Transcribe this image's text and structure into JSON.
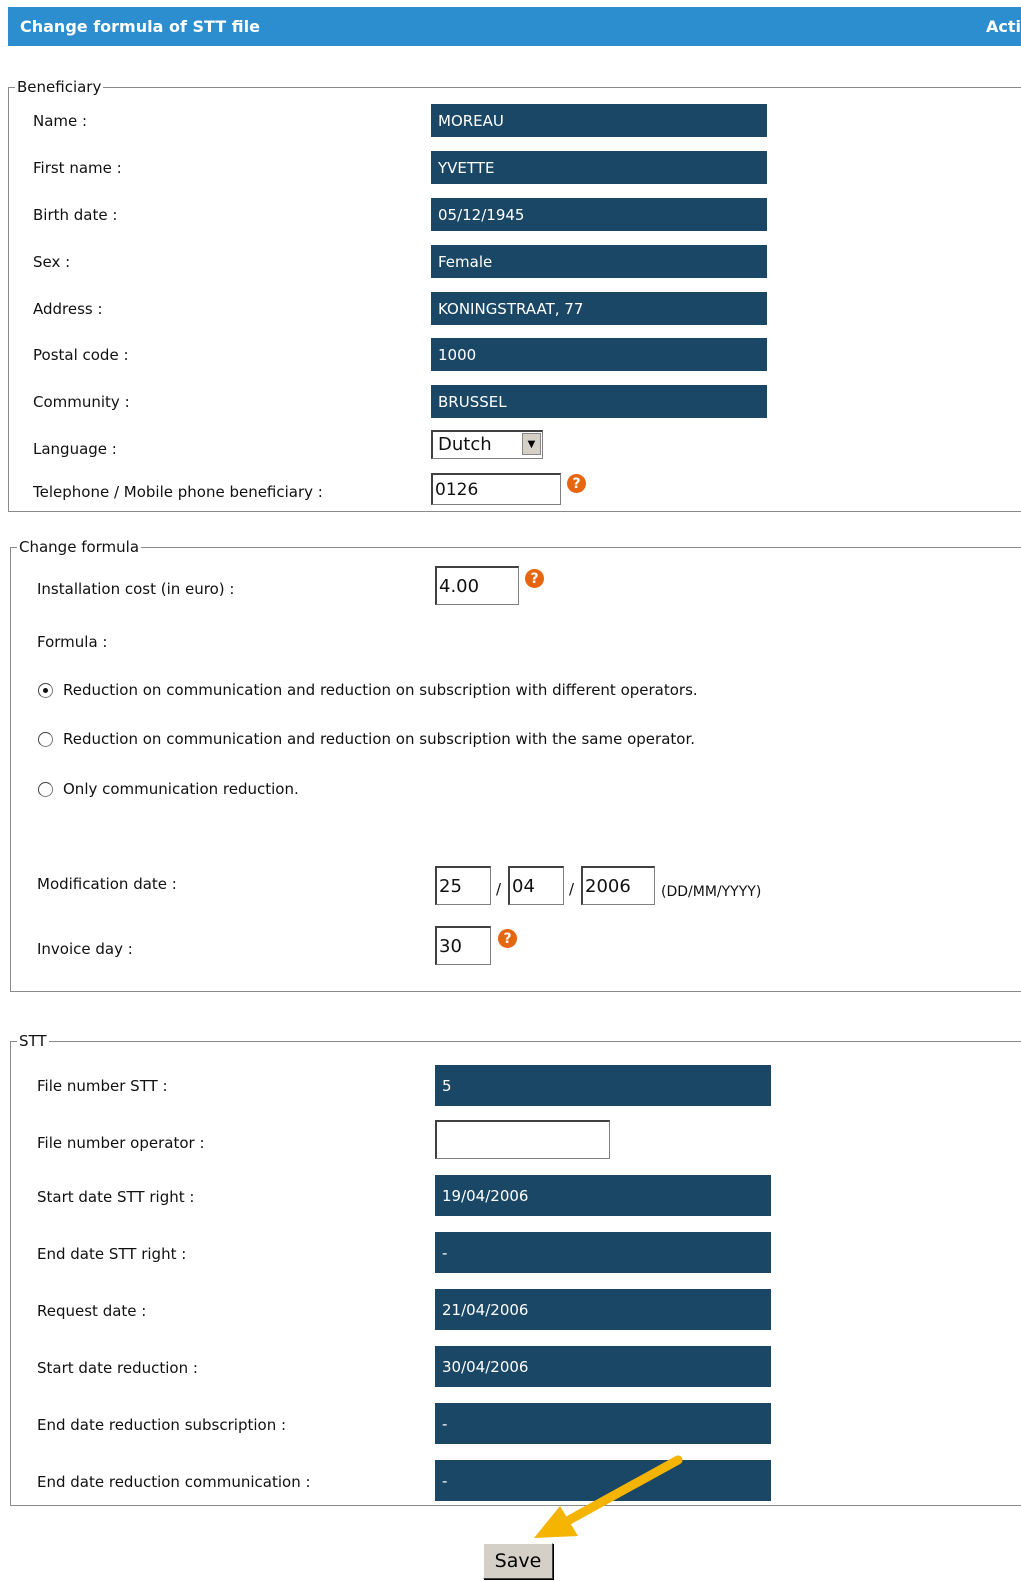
{
  "header": {
    "title": "Change formula of STT file",
    "right_label": "Acti"
  },
  "beneficiary": {
    "legend": "Beneficiary",
    "fields": [
      {
        "label": "Name :",
        "value": "MOREAU"
      },
      {
        "label": "First name :",
        "value": "YVETTE"
      },
      {
        "label": "Birth date :",
        "value": "05/12/1945"
      },
      {
        "label": "Sex :",
        "value": "Female"
      },
      {
        "label": "Address :",
        "value": "KONINGSTRAAT, 77"
      },
      {
        "label": "Postal code :",
        "value": "1000"
      },
      {
        "label": "Community :",
        "value": "BRUSSEL"
      }
    ],
    "language_label": "Language :",
    "language_value": "Dutch",
    "phone_label": "Telephone / Mobile phone beneficiary :",
    "phone_value": "0126"
  },
  "change_formula": {
    "legend": "Change formula",
    "installation_label": "Installation cost (in euro) :",
    "installation_value": "4.00",
    "formula_label": "Formula :",
    "options": [
      "Reduction on communication and reduction on subscription with different operators.",
      "Reduction on communication and reduction on subscription with the same operator.",
      "Only communication reduction."
    ],
    "selected_option": 0,
    "modification_label": "Modification date :",
    "mod_day": "25",
    "mod_month": "04",
    "mod_year": "2006",
    "date_sep": "/",
    "date_format": "(DD/MM/YYYY)",
    "invoice_label": "Invoice day :",
    "invoice_value": "30"
  },
  "stt": {
    "legend": "STT",
    "file_number_label": "File number STT :",
    "file_number_value": "5",
    "operator_label": "File number operator :",
    "operator_value": "",
    "rows": [
      {
        "label": "Start date STT right :",
        "value": "19/04/2006"
      },
      {
        "label": "End date STT right :",
        "value": "-"
      },
      {
        "label": "Request date :",
        "value": "21/04/2006"
      },
      {
        "label": "Start date reduction :",
        "value": "30/04/2006"
      },
      {
        "label": "End date reduction subscription :",
        "value": "-"
      },
      {
        "label": "End date reduction communication :",
        "value": "-"
      }
    ]
  },
  "actions": {
    "save_label": "Save"
  },
  "icons": {
    "help": "help-icon",
    "arrow": "pointer-arrow",
    "dropdown": "chevron-down-icon"
  },
  "colors": {
    "header_bg": "#2d8ecf",
    "readonly_bg": "#1a4766",
    "help_orange": "#e8650f",
    "arrow_yellow": "#f5b400"
  }
}
